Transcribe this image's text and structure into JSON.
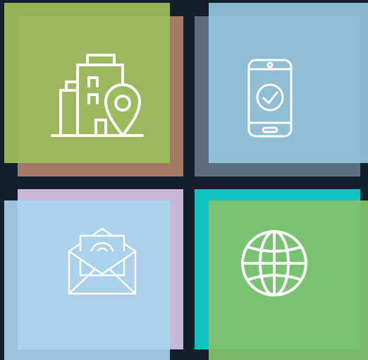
{
  "tiles": [
    {
      "name": "location",
      "icon": "building-location-pin-icon",
      "back_color": "#a67965",
      "front_color": "#9cba5e"
    },
    {
      "name": "mobile",
      "icon": "smartphone-check-icon",
      "back_color": "#5f6f7f",
      "front_color": "#94c4dc"
    },
    {
      "name": "email",
      "icon": "envelope-at-icon",
      "back_color": "#c8b8d6",
      "front_color": "#a8d2ee"
    },
    {
      "name": "web",
      "icon": "globe-icon",
      "back_color": "#10c3c3",
      "front_color": "#7fc26e"
    }
  ],
  "colors": {
    "background": "#141f2c",
    "icon_stroke": "#ffffff"
  }
}
